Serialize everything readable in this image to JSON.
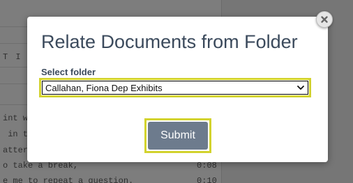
{
  "background": {
    "lines": [
      {
        "text": "T I",
        "time": ""
      },
      {
        "text": "int w",
        "time": ""
      },
      {
        "text": " in t",
        "time": ""
      },
      {
        "text": "atter",
        "time": ""
      },
      {
        "text": "o take a break,",
        "time": "0:08"
      },
      {
        "text": "e me to repeat a question.",
        "time": "0:10"
      }
    ]
  },
  "modal": {
    "title": "Relate Documents from Folder",
    "select_label": "Select folder",
    "selected_folder": "Callahan, Fiona Dep Exhibits",
    "submit_label": "Submit",
    "close_icon": "close-icon",
    "highlight_color": "#d3d32e",
    "button_color": "#6d7b8d",
    "title_color": "#3b4a5c"
  }
}
